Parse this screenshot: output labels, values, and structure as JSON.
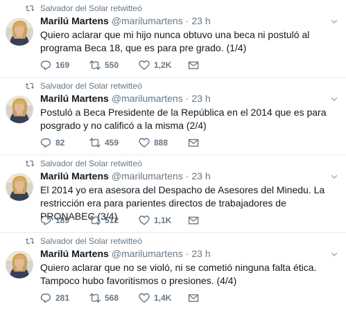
{
  "tweets": [
    {
      "retweet_context": "Salvador del Solar retwitteó",
      "fullname": "Marilú Martens",
      "username": "@marilumartens",
      "dot": "·",
      "time": "23 h",
      "text": "Quiero aclarar que mi hijo nunca obtuvo una beca ni postuló al programa Beca 18, que es para pre grado. (1/4)",
      "replies": "169",
      "retweets": "550",
      "likes": "1,2K"
    },
    {
      "retweet_context": "Salvador del Solar retwitteó",
      "fullname": "Marilú Martens",
      "username": "@marilumartens",
      "dot": "·",
      "time": "23 h",
      "text": "Postuló a Beca Presidente de la República en el 2014 que es para posgrado y no calificó a la misma (2/4)",
      "replies": "82",
      "retweets": "459",
      "likes": "888"
    },
    {
      "retweet_context": "Salvador del Solar retwitteó",
      "fullname": "Marilú Martens",
      "username": "@marilumartens",
      "dot": "·",
      "time": "23 h",
      "text": "El 2014 yo era asesora del Despacho de Asesores del Minedu. La restricción era para parientes directos de trabajadores de PRONABEC (3/4)",
      "replies": "189",
      "retweets": "512",
      "likes": "1,1K"
    },
    {
      "retweet_context": "Salvador del Solar retwitteó",
      "fullname": "Marilú Martens",
      "username": "@marilumartens",
      "dot": "·",
      "time": "23 h",
      "text": "Quiero aclarar que no se violó, ni se cometió ninguna falta ética.  Tampoco hubo favoritismos o presiones. (4/4)",
      "replies": "281",
      "retweets": "568",
      "likes": "1,4K"
    }
  ],
  "icons": {
    "retweet_context": "retweet-icon",
    "reply": "reply-icon",
    "retweet": "retweet-icon",
    "like": "heart-icon",
    "dm": "envelope-icon",
    "caret": "chevron-down-icon"
  },
  "colors": {
    "text": "#14171a",
    "muted": "#657786",
    "divider": "#e6ecf0"
  }
}
